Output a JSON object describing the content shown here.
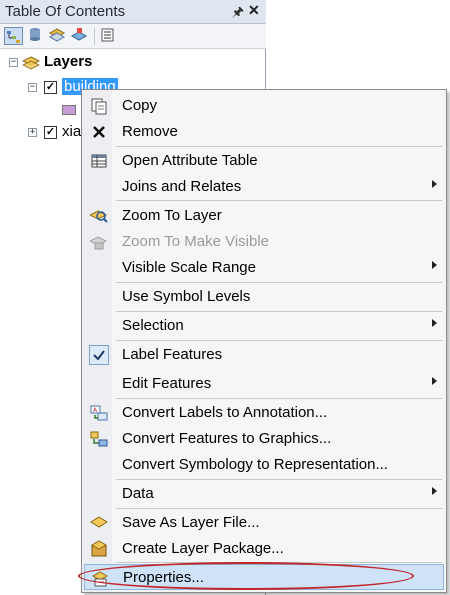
{
  "toc": {
    "title": "Table Of Contents",
    "pin_icon": "pin-icon",
    "close_icon": "close-icon",
    "toolbar": [
      "list-by-drawing-order-icon",
      "list-by-source-icon",
      "list-by-visibility-icon",
      "list-by-selection-icon",
      "options-icon"
    ],
    "tree": {
      "root_label": "Layers",
      "layers": [
        {
          "label": "building",
          "checked": true,
          "expanded": true,
          "selected": true
        },
        {
          "label": "xia",
          "checked": true,
          "expanded": false,
          "selected": false
        }
      ]
    }
  },
  "context_menu": {
    "items": [
      {
        "label": "Copy",
        "icon": "copy-icon"
      },
      {
        "label": "Remove",
        "icon": "remove-icon"
      },
      {
        "label": "Open Attribute Table",
        "icon": "table-icon"
      },
      {
        "label": "Joins and Relates",
        "submenu": true
      },
      {
        "label": "Zoom To Layer",
        "icon": "zoom-to-layer-icon"
      },
      {
        "label": "Zoom To Make Visible",
        "icon": "zoom-visible-icon",
        "disabled": true
      },
      {
        "label": "Visible Scale Range",
        "submenu": true
      },
      {
        "label": "Use Symbol Levels"
      },
      {
        "label": "Selection",
        "submenu": true
      },
      {
        "label": "Label Features",
        "checked": true
      },
      {
        "label": "Edit Features",
        "submenu": true
      },
      {
        "label": "Convert Labels to Annotation...",
        "icon": "convert-labels-icon"
      },
      {
        "label": "Convert Features to Graphics...",
        "icon": "convert-features-icon"
      },
      {
        "label": "Convert Symbology to Representation..."
      },
      {
        "label": "Data",
        "submenu": true
      },
      {
        "label": "Save As Layer File...",
        "icon": "save-layer-icon"
      },
      {
        "label": "Create Layer Package...",
        "icon": "layer-package-icon"
      },
      {
        "label": "Properties...",
        "icon": "properties-icon",
        "hovered": true
      }
    ]
  },
  "colors": {
    "selection": "#3399ff",
    "menu_hover": "#cfe3f8",
    "annotation_ring": "#c0262a"
  }
}
